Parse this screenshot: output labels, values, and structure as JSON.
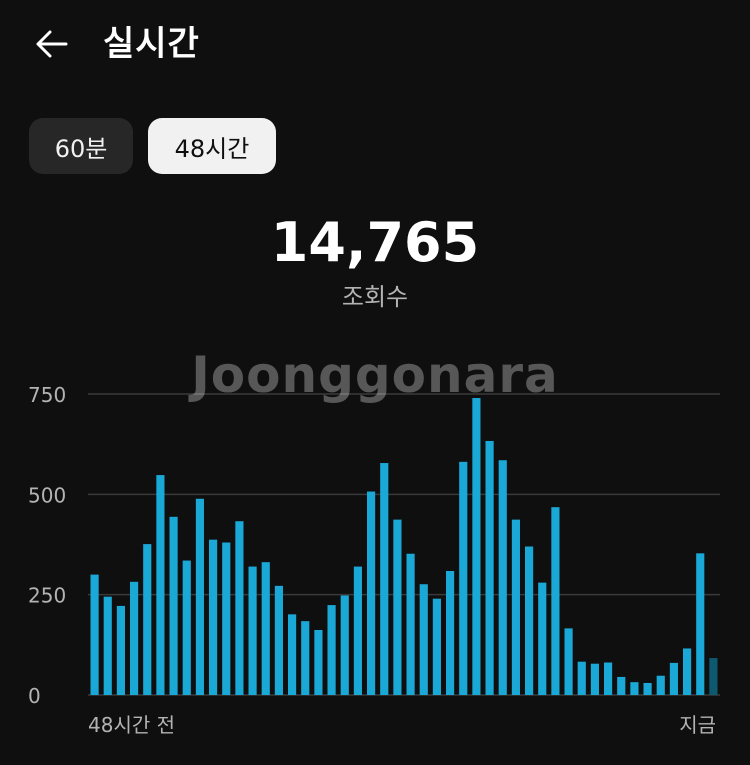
{
  "header": {
    "title": "실시간",
    "back_icon": "arrow-left-icon"
  },
  "filters": {
    "tab_60min": "60분",
    "tab_48h": "48시간",
    "selected": "48시간"
  },
  "metric": {
    "value": "14,765",
    "label": "조회수"
  },
  "watermark": "Joonggonara",
  "colors": {
    "background": "#0f0f0f",
    "bar": "#1aa8d6",
    "bar_current": "#0d5a70",
    "grid": "#3a3a3a"
  },
  "chart_data": {
    "type": "bar",
    "x_start_label": "48시간 전",
    "x_end_label": "지금",
    "yticks": [
      "750",
      "500",
      "250",
      "0"
    ],
    "ylim": [
      0,
      750
    ],
    "grid": true,
    "values": [
      300,
      245,
      222,
      282,
      376,
      548,
      444,
      335,
      489,
      387,
      380,
      433,
      320,
      331,
      272,
      201,
      184,
      162,
      224,
      248,
      320,
      507,
      578,
      437,
      352,
      276,
      240,
      309,
      581,
      740,
      633,
      585,
      437,
      370,
      280,
      468,
      166,
      83,
      78,
      81,
      45,
      32,
      30,
      48,
      80,
      116,
      353,
      92
    ]
  }
}
